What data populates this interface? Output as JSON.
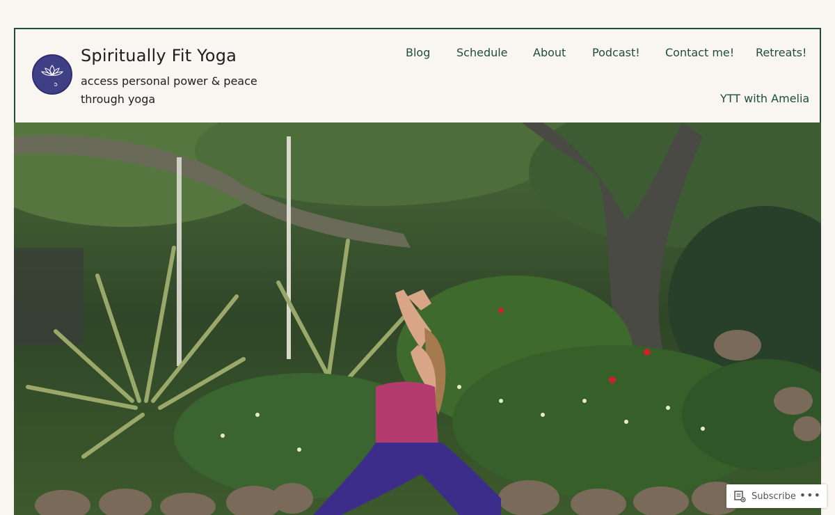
{
  "site": {
    "title": "Spiritually Fit Yoga",
    "tagline": "access personal power & peace through yoga",
    "logo_text": "SPIRITUALLY FIT"
  },
  "nav": {
    "items": [
      {
        "label": "Blog"
      },
      {
        "label": "Schedule"
      },
      {
        "label": "About"
      },
      {
        "label": "Podcast!"
      },
      {
        "label": "Contact me!"
      },
      {
        "label": "Retreats!"
      },
      {
        "label": "YTT with Amelia"
      }
    ]
  },
  "subscribe_bar": {
    "label": "Subscribe",
    "more_label": "•••",
    "icon": "reader-icon"
  },
  "colors": {
    "background": "#f9f6f1",
    "accent": "#1f4d3d",
    "logo": "#3f3f86"
  }
}
